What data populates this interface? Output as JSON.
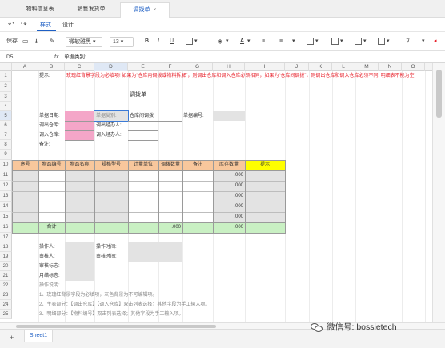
{
  "tabs": [
    {
      "label": "物料信息表",
      "active": false
    },
    {
      "label": "销售发货单",
      "active": false
    },
    {
      "label": "调拨单",
      "active": true
    }
  ],
  "menu": {
    "items": [
      "样式",
      "设计"
    ],
    "active_index": 0
  },
  "toolbar": {
    "save_label": "保存",
    "font_family": "微软雅黑",
    "font_size": "13",
    "bold": "B",
    "italic": "I",
    "underline": "U"
  },
  "formula_bar": {
    "cell_ref": "D5",
    "fx": "fx",
    "content": "单据类别:"
  },
  "columns": [
    "A",
    "B",
    "C",
    "D",
    "E",
    "F",
    "G",
    "H",
    "I",
    "J",
    "K",
    "L",
    "M",
    "N",
    "O",
    "P"
  ],
  "rows": [
    "1",
    "2",
    "3",
    "4",
    "5",
    "6",
    "7",
    "8",
    "9",
    "10",
    "11",
    "12",
    "13",
    "14",
    "15",
    "16",
    "17",
    "18",
    "19",
    "20",
    "21",
    "22",
    "23",
    "24",
    "25"
  ],
  "sheet": {
    "hint_label": "提示:",
    "hint_text": "玫瑰红背景字段为必填项! 如果为“仓库内调拨或物料拆解”，则调出仓库和调入仓库必须相同，如果为“仓库间调拨”，则调出仓库和调入仓库必须不同! 明细表不能为空!",
    "title": "调拨单",
    "header": {
      "date_label": "单据日期:",
      "category_label": "单据类别:",
      "category_value": "仓库间调拨",
      "number_label": "单据编号:",
      "out_wh_label": "调出仓库:",
      "out_handler_label": "调出经办人:",
      "in_wh_label": "调入仓库:",
      "in_handler_label": "调入经办人:",
      "remark_label": "备注:"
    },
    "detail_headers": [
      "序号",
      "物品编号",
      "物品名称",
      "规格型号",
      "计量单位",
      "调拨数量",
      "备注",
      "库存数量",
      "提示"
    ],
    "stock_values": [
      ".000",
      ".000",
      ".000",
      ".000",
      ".000"
    ],
    "total_label": "合计",
    "total_qty": ".000",
    "total_stock": ".000",
    "footer": {
      "operator_label": "操作人:",
      "op_time_label": "操作时间:",
      "reviewer_label": "审核人:",
      "review_time_label": "审核时间:",
      "review_flag_label": "审核标志:",
      "month_flag_label": "月结标志:",
      "notes_title": "操作说明:",
      "note1": "1、玫瑰红背景字段为必填项，灰色背景为不可编辑项。",
      "note2": "2、主表部分：【调出仓库】【调入仓库】双击列表选择；其他字段为手工输入项。",
      "note3": "3、明细部分：【物料编号】双击列表选择；其他字段为手工输入项。"
    }
  },
  "sheet_tabs": [
    "Sheet1"
  ],
  "watermark": "微信号: bossietech",
  "colors": {
    "accent": "#1e5fc4",
    "required_pink": "#f4a6c8",
    "readonly_gray": "#e3e3e3",
    "header_orange": "#f8c79c",
    "hint_yellow": "#ffff00",
    "total_green": "#c9f0c3",
    "hint_red": "#e8202a"
  }
}
